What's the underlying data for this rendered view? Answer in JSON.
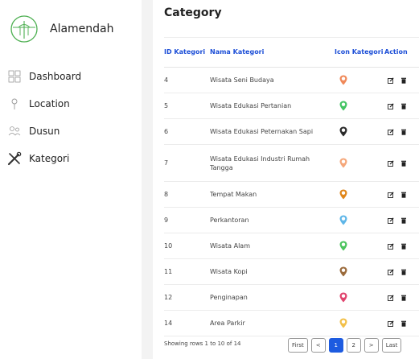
{
  "app": {
    "name": "Alamendah"
  },
  "sidebar": {
    "items": [
      {
        "label": "Dashboard",
        "icon": "dashboard-grid-icon"
      },
      {
        "label": "Location",
        "icon": "location-pin-icon"
      },
      {
        "label": "Dusun",
        "icon": "people-icon"
      },
      {
        "label": "Kategori",
        "icon": "tools-icon"
      }
    ]
  },
  "page": {
    "title": "Category"
  },
  "table": {
    "headers": {
      "id": "ID Kategori",
      "name": "Nama Kategori",
      "icon": "Icon Kategori",
      "action": "Action"
    },
    "rows": [
      {
        "id": "4",
        "name": "Wisata Seni Budaya",
        "marker_color": "#f0895a"
      },
      {
        "id": "5",
        "name": "Wisata Edukasi Pertanian",
        "marker_color": "#43c463"
      },
      {
        "id": "6",
        "name": "Wisata Edukasi Peternakan Sapi",
        "marker_color": "#2b2b2b"
      },
      {
        "id": "7",
        "name": "Wisata Edukasi Industri Rumah Tangga",
        "marker_color": "#f5a77a"
      },
      {
        "id": "8",
        "name": "Tempat Makan",
        "marker_color": "#e0861a"
      },
      {
        "id": "9",
        "name": "Perkantoran",
        "marker_color": "#5fb6e8"
      },
      {
        "id": "10",
        "name": "Wisata Alam",
        "marker_color": "#4cc45e"
      },
      {
        "id": "11",
        "name": "Wisata Kopi",
        "marker_color": "#9b6b3c"
      },
      {
        "id": "12",
        "name": "Penginapan",
        "marker_color": "#e0456e"
      },
      {
        "id": "14",
        "name": "Area Parkir",
        "marker_color": "#f2c04a"
      }
    ]
  },
  "footer": {
    "showing": "Showing rows 1 to 10 of 14"
  },
  "pagination": {
    "first": "First",
    "prev": "<",
    "pages": [
      "1",
      "2"
    ],
    "active": "1",
    "next": ">",
    "last": "Last"
  },
  "colors": {
    "accent": "#1d4fd7",
    "active_page": "#1d5be0",
    "brand_logo": "#4caf50"
  }
}
